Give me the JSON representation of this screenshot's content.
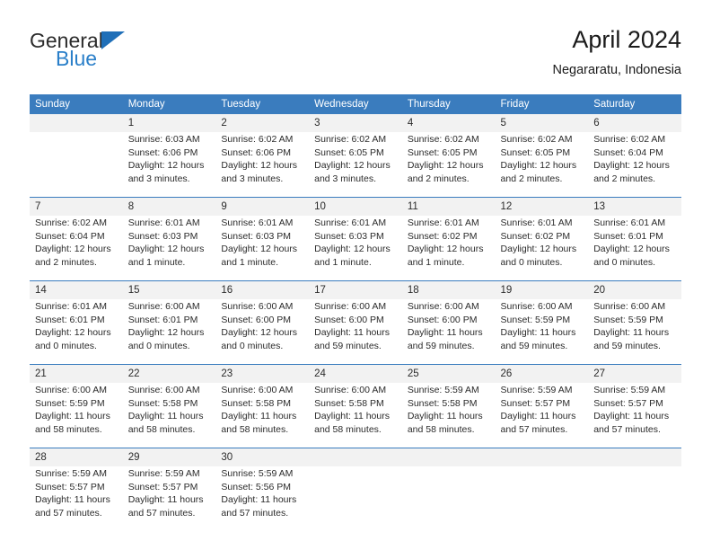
{
  "logo": {
    "word1": "General",
    "word2": "Blue",
    "triangle_color": "#1f6fb8",
    "blue_color": "#2a7fc9"
  },
  "header": {
    "title": "April 2024",
    "subtitle": "Negararatu, Indonesia"
  },
  "theme": {
    "header_bg": "#3a7cbe",
    "daynum_bg": "#f2f2f2",
    "text": "#2b2b2b"
  },
  "weekday_headers": [
    "Sunday",
    "Monday",
    "Tuesday",
    "Wednesday",
    "Thursday",
    "Friday",
    "Saturday"
  ],
  "weeks": [
    [
      {
        "day": "",
        "lines": []
      },
      {
        "day": "1",
        "lines": [
          "Sunrise: 6:03 AM",
          "Sunset: 6:06 PM",
          "Daylight: 12 hours",
          "and 3 minutes."
        ]
      },
      {
        "day": "2",
        "lines": [
          "Sunrise: 6:02 AM",
          "Sunset: 6:06 PM",
          "Daylight: 12 hours",
          "and 3 minutes."
        ]
      },
      {
        "day": "3",
        "lines": [
          "Sunrise: 6:02 AM",
          "Sunset: 6:05 PM",
          "Daylight: 12 hours",
          "and 3 minutes."
        ]
      },
      {
        "day": "4",
        "lines": [
          "Sunrise: 6:02 AM",
          "Sunset: 6:05 PM",
          "Daylight: 12 hours",
          "and 2 minutes."
        ]
      },
      {
        "day": "5",
        "lines": [
          "Sunrise: 6:02 AM",
          "Sunset: 6:05 PM",
          "Daylight: 12 hours",
          "and 2 minutes."
        ]
      },
      {
        "day": "6",
        "lines": [
          "Sunrise: 6:02 AM",
          "Sunset: 6:04 PM",
          "Daylight: 12 hours",
          "and 2 minutes."
        ]
      }
    ],
    [
      {
        "day": "7",
        "lines": [
          "Sunrise: 6:02 AM",
          "Sunset: 6:04 PM",
          "Daylight: 12 hours",
          "and 2 minutes."
        ]
      },
      {
        "day": "8",
        "lines": [
          "Sunrise: 6:01 AM",
          "Sunset: 6:03 PM",
          "Daylight: 12 hours",
          "and 1 minute."
        ]
      },
      {
        "day": "9",
        "lines": [
          "Sunrise: 6:01 AM",
          "Sunset: 6:03 PM",
          "Daylight: 12 hours",
          "and 1 minute."
        ]
      },
      {
        "day": "10",
        "lines": [
          "Sunrise: 6:01 AM",
          "Sunset: 6:03 PM",
          "Daylight: 12 hours",
          "and 1 minute."
        ]
      },
      {
        "day": "11",
        "lines": [
          "Sunrise: 6:01 AM",
          "Sunset: 6:02 PM",
          "Daylight: 12 hours",
          "and 1 minute."
        ]
      },
      {
        "day": "12",
        "lines": [
          "Sunrise: 6:01 AM",
          "Sunset: 6:02 PM",
          "Daylight: 12 hours",
          "and 0 minutes."
        ]
      },
      {
        "day": "13",
        "lines": [
          "Sunrise: 6:01 AM",
          "Sunset: 6:01 PM",
          "Daylight: 12 hours",
          "and 0 minutes."
        ]
      }
    ],
    [
      {
        "day": "14",
        "lines": [
          "Sunrise: 6:01 AM",
          "Sunset: 6:01 PM",
          "Daylight: 12 hours",
          "and 0 minutes."
        ]
      },
      {
        "day": "15",
        "lines": [
          "Sunrise: 6:00 AM",
          "Sunset: 6:01 PM",
          "Daylight: 12 hours",
          "and 0 minutes."
        ]
      },
      {
        "day": "16",
        "lines": [
          "Sunrise: 6:00 AM",
          "Sunset: 6:00 PM",
          "Daylight: 12 hours",
          "and 0 minutes."
        ]
      },
      {
        "day": "17",
        "lines": [
          "Sunrise: 6:00 AM",
          "Sunset: 6:00 PM",
          "Daylight: 11 hours",
          "and 59 minutes."
        ]
      },
      {
        "day": "18",
        "lines": [
          "Sunrise: 6:00 AM",
          "Sunset: 6:00 PM",
          "Daylight: 11 hours",
          "and 59 minutes."
        ]
      },
      {
        "day": "19",
        "lines": [
          "Sunrise: 6:00 AM",
          "Sunset: 5:59 PM",
          "Daylight: 11 hours",
          "and 59 minutes."
        ]
      },
      {
        "day": "20",
        "lines": [
          "Sunrise: 6:00 AM",
          "Sunset: 5:59 PM",
          "Daylight: 11 hours",
          "and 59 minutes."
        ]
      }
    ],
    [
      {
        "day": "21",
        "lines": [
          "Sunrise: 6:00 AM",
          "Sunset: 5:59 PM",
          "Daylight: 11 hours",
          "and 58 minutes."
        ]
      },
      {
        "day": "22",
        "lines": [
          "Sunrise: 6:00 AM",
          "Sunset: 5:58 PM",
          "Daylight: 11 hours",
          "and 58 minutes."
        ]
      },
      {
        "day": "23",
        "lines": [
          "Sunrise: 6:00 AM",
          "Sunset: 5:58 PM",
          "Daylight: 11 hours",
          "and 58 minutes."
        ]
      },
      {
        "day": "24",
        "lines": [
          "Sunrise: 6:00 AM",
          "Sunset: 5:58 PM",
          "Daylight: 11 hours",
          "and 58 minutes."
        ]
      },
      {
        "day": "25",
        "lines": [
          "Sunrise: 5:59 AM",
          "Sunset: 5:58 PM",
          "Daylight: 11 hours",
          "and 58 minutes."
        ]
      },
      {
        "day": "26",
        "lines": [
          "Sunrise: 5:59 AM",
          "Sunset: 5:57 PM",
          "Daylight: 11 hours",
          "and 57 minutes."
        ]
      },
      {
        "day": "27",
        "lines": [
          "Sunrise: 5:59 AM",
          "Sunset: 5:57 PM",
          "Daylight: 11 hours",
          "and 57 minutes."
        ]
      }
    ],
    [
      {
        "day": "28",
        "lines": [
          "Sunrise: 5:59 AM",
          "Sunset: 5:57 PM",
          "Daylight: 11 hours",
          "and 57 minutes."
        ]
      },
      {
        "day": "29",
        "lines": [
          "Sunrise: 5:59 AM",
          "Sunset: 5:57 PM",
          "Daylight: 11 hours",
          "and 57 minutes."
        ]
      },
      {
        "day": "30",
        "lines": [
          "Sunrise: 5:59 AM",
          "Sunset: 5:56 PM",
          "Daylight: 11 hours",
          "and 57 minutes."
        ]
      },
      {
        "day": "",
        "lines": []
      },
      {
        "day": "",
        "lines": []
      },
      {
        "day": "",
        "lines": []
      },
      {
        "day": "",
        "lines": []
      }
    ]
  ]
}
